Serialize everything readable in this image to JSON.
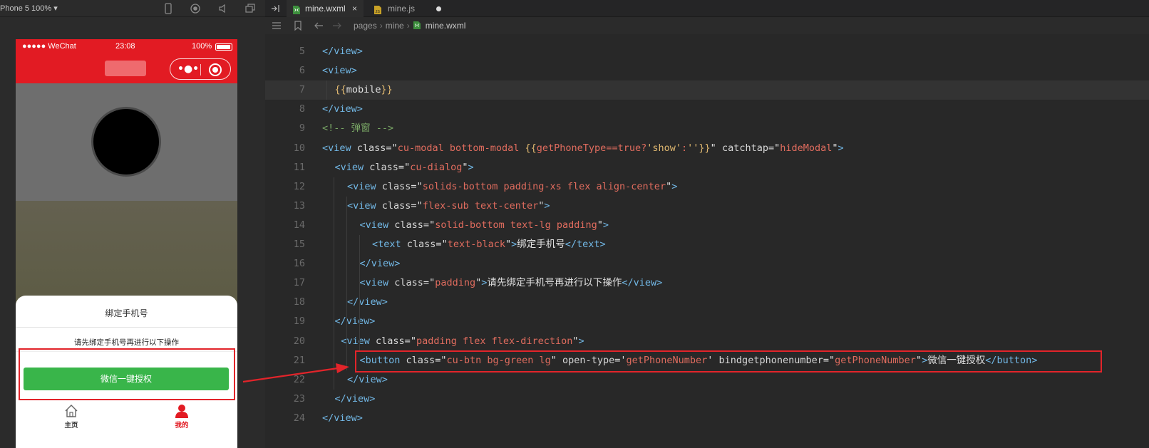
{
  "simulator": {
    "device_label": "Phone 5 100% ▾",
    "status_bar": {
      "carrier": "●●●●● WeChat",
      "time": "23:08",
      "battery": "100%"
    },
    "modal": {
      "title": "绑定手机号",
      "description": "请先绑定手机号再进行以下操作",
      "button": "微信一键授权"
    },
    "tabbar": [
      {
        "label": "主页",
        "icon": "home-icon"
      },
      {
        "label": "我的",
        "icon": "user-icon"
      }
    ],
    "colors": {
      "nav_red": "#e21b23",
      "button_green": "#39b54a"
    }
  },
  "editor": {
    "tabs": [
      {
        "label": "mine.wxml",
        "close": "×",
        "active": true
      },
      {
        "label": "mine.js",
        "modified": true,
        "active": false
      }
    ],
    "breadcrumb": [
      "pages",
      "mine",
      "mine.wxml"
    ],
    "lines": [
      {
        "n": "5",
        "t": "</view>"
      },
      {
        "n": "6",
        "t": "<view>"
      },
      {
        "n": "7",
        "t": "{{mobile}}"
      },
      {
        "n": "8",
        "t": "</view>"
      },
      {
        "n": "9",
        "t": "<!-- 弹窗 -->"
      },
      {
        "n": "10",
        "t": "<view class=\"cu-modal bottom-modal {{getPhoneType==true?'show':''}}\" catchtap=\"hideModal\">"
      },
      {
        "n": "11",
        "t": "<view class=\"cu-dialog\">"
      },
      {
        "n": "12",
        "t": "<view class=\"solids-bottom padding-xs flex align-center\">"
      },
      {
        "n": "13",
        "t": "<view class=\"flex-sub text-center\">"
      },
      {
        "n": "14",
        "t": "<view class=\"solid-bottom text-lg padding\">"
      },
      {
        "n": "15",
        "t": "<text class=\"text-black\">绑定手机号</text>"
      },
      {
        "n": "16",
        "t": "</view>"
      },
      {
        "n": "17",
        "t": "<view class=\"padding\">请先绑定手机号再进行以下操作</view>"
      },
      {
        "n": "18",
        "t": "</view>"
      },
      {
        "n": "19",
        "t": "</view>"
      },
      {
        "n": "20",
        "t": "<view class=\"padding flex flex-direction\">"
      },
      {
        "n": "21",
        "t": "<button class=\"cu-btn bg-green lg\" open-type='getPhoneNumber' bindgetphonenumber=\"getPhoneNumber\">微信一键授权</button>"
      },
      {
        "n": "22",
        "t": "</view>"
      },
      {
        "n": "23",
        "t": "</view>"
      },
      {
        "n": "24",
        "t": "</view>"
      }
    ]
  }
}
